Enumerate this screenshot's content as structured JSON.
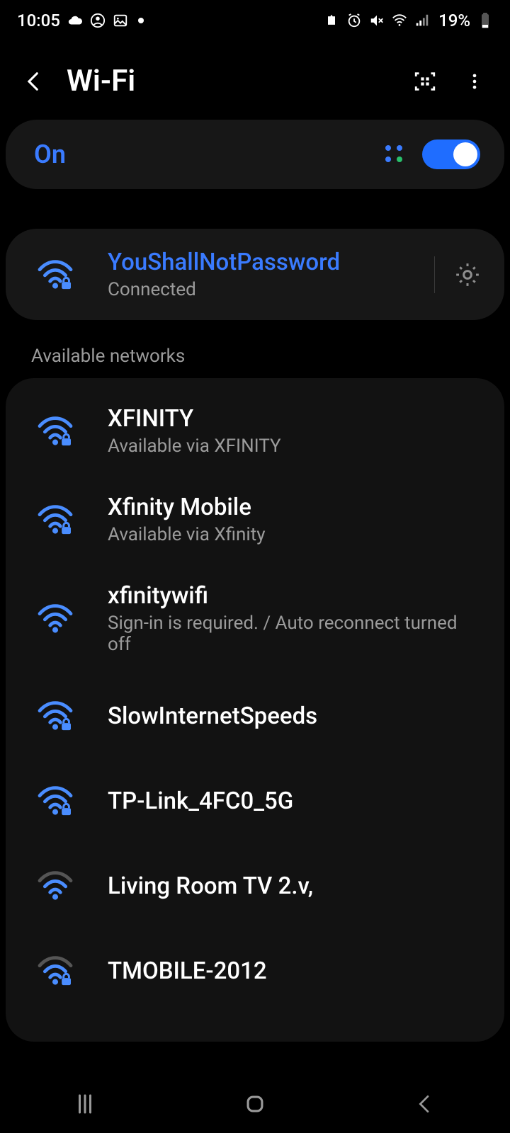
{
  "status": {
    "time": "10:05",
    "battery_pct": "19%"
  },
  "header": {
    "title": "Wi-Fi"
  },
  "wifi": {
    "state_label": "On",
    "enabled": true,
    "connected": {
      "ssid": "YouShallNotPassword",
      "status": "Connected"
    }
  },
  "available_label": "Available networks",
  "networks": [
    {
      "ssid": "XFINITY",
      "sub": "Available via XFINITY",
      "secured": true,
      "strength": 4
    },
    {
      "ssid": "Xfinity Mobile",
      "sub": "Available via Xfinity",
      "secured": true,
      "strength": 4
    },
    {
      "ssid": "xfinitywifi",
      "sub": "Sign-in is required. / Auto reconnect turned off",
      "secured": false,
      "strength": 4
    },
    {
      "ssid": "SlowInternetSpeeds",
      "sub": "",
      "secured": true,
      "strength": 4
    },
    {
      "ssid": "TP-Link_4FC0_5G",
      "sub": "",
      "secured": true,
      "strength": 4
    },
    {
      "ssid": "Living Room TV 2.v,",
      "sub": "",
      "secured": false,
      "strength": 3
    },
    {
      "ssid": "TMOBILE-2012",
      "sub": "",
      "secured": true,
      "strength": 3
    }
  ],
  "colors": {
    "accent": "#3a7bff",
    "wifi_icon": "#4a8dff",
    "muted": "#9b9b9b"
  }
}
